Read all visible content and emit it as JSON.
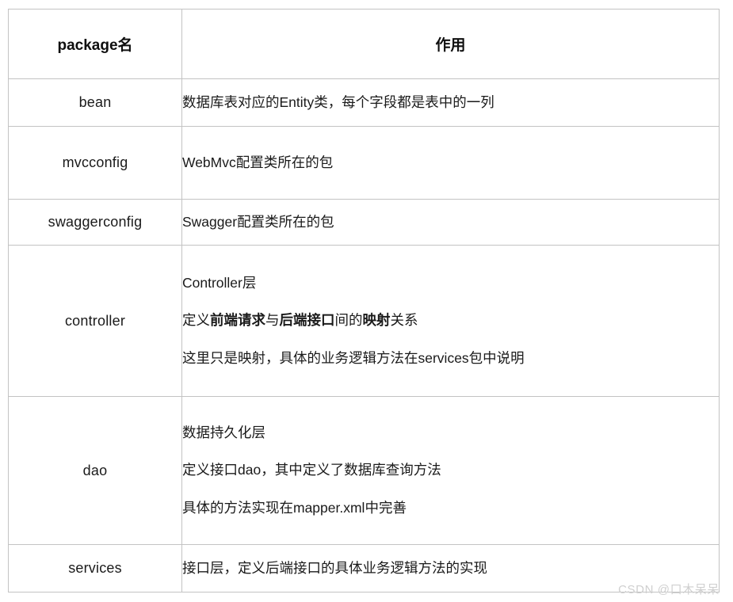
{
  "table": {
    "columns": [
      {
        "key": "package",
        "header": "package名"
      },
      {
        "key": "role",
        "header": "作用"
      }
    ],
    "rows": [
      {
        "package": "bean",
        "lines": [
          {
            "segments": [
              {
                "text": "数据库表对应的Entity类，每个字段都是表中的一列",
                "bold": false
              }
            ]
          }
        ]
      },
      {
        "package": "mvcconfig",
        "lines": [
          {
            "segments": [
              {
                "text": "WebMvc配置类所在的包",
                "bold": false
              }
            ]
          }
        ]
      },
      {
        "package": "swaggerconfig",
        "lines": [
          {
            "segments": [
              {
                "text": "Swagger配置类所在的包",
                "bold": false
              }
            ]
          }
        ]
      },
      {
        "package": "controller",
        "lines": [
          {
            "segments": [
              {
                "text": "Controller层",
                "bold": false
              }
            ]
          },
          {
            "segments": [
              {
                "text": "定义",
                "bold": false
              },
              {
                "text": "前端请求",
                "bold": true
              },
              {
                "text": "与",
                "bold": false
              },
              {
                "text": "后端接口",
                "bold": true
              },
              {
                "text": "间的",
                "bold": false
              },
              {
                "text": "映射",
                "bold": true
              },
              {
                "text": "关系",
                "bold": false
              }
            ]
          },
          {
            "segments": [
              {
                "text": "这里只是映射，具体的业务逻辑方法在services包中说明",
                "bold": false
              }
            ]
          }
        ]
      },
      {
        "package": "dao",
        "lines": [
          {
            "segments": [
              {
                "text": "数据持久化层",
                "bold": false
              }
            ]
          },
          {
            "segments": [
              {
                "text": "定义接口dao，其中定义了数据库查询方法",
                "bold": false
              }
            ]
          },
          {
            "segments": [
              {
                "text": "具体的方法实现在mapper.xml中完善",
                "bold": false
              }
            ]
          }
        ]
      },
      {
        "package": "services",
        "lines": [
          {
            "segments": [
              {
                "text": "接口层，定义后端接口的具体业务逻辑方法的实现",
                "bold": false
              }
            ]
          }
        ]
      }
    ]
  },
  "watermark": {
    "text": "CSDN @口木呆呆"
  },
  "colors": {
    "border": "#c3c3c3",
    "text": "#1a1a1a",
    "watermark": "#cfcfcf",
    "background": "#ffffff"
  }
}
